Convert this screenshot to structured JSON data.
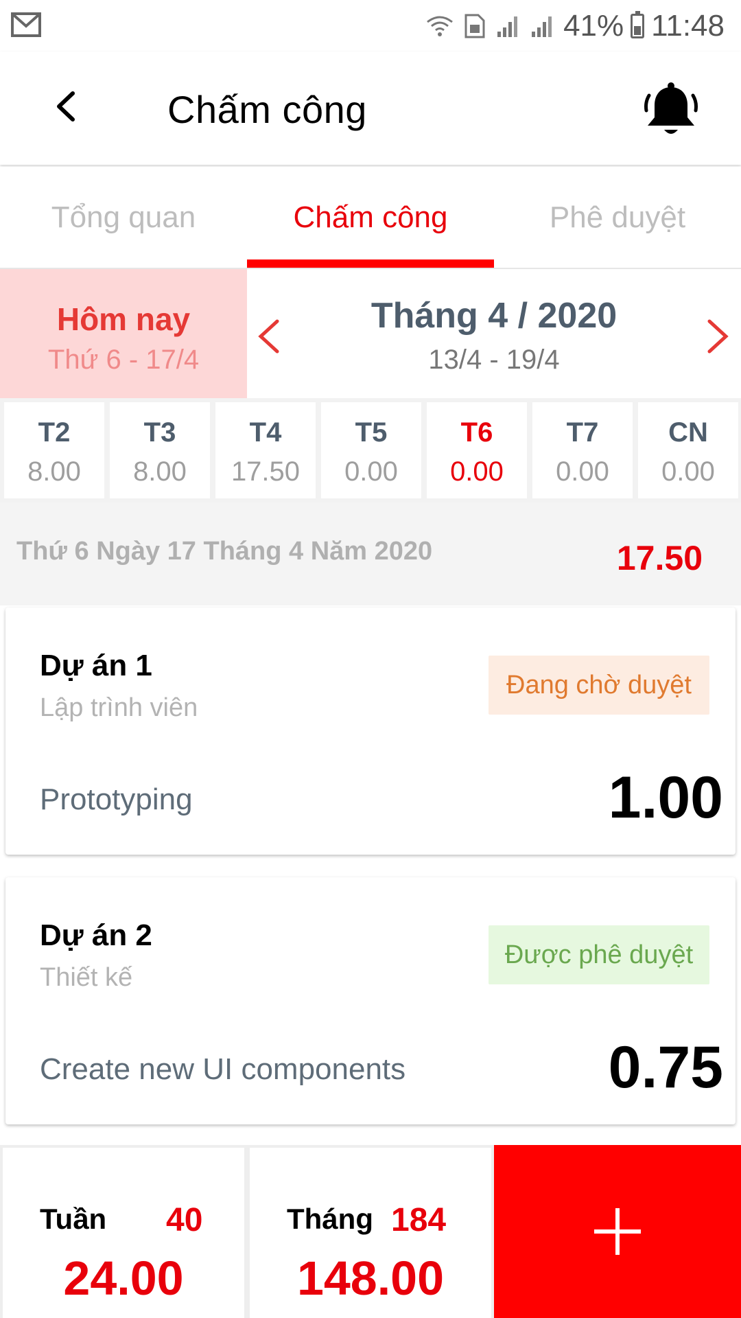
{
  "status_bar": {
    "battery": "41%",
    "time": "11:48",
    "icons": [
      "gmail-icon",
      "wifi-icon",
      "data-sim-icon",
      "signal-icon",
      "signal-icon",
      "battery-icon"
    ]
  },
  "app_bar": {
    "title": "Chấm công",
    "back_icon": "chevron-left-icon",
    "notification_icon": "bell-icon"
  },
  "tabs": [
    {
      "label": "Tổng quan",
      "active": false
    },
    {
      "label": "Chấm công",
      "active": true
    },
    {
      "label": "Phê duyệt",
      "active": false
    }
  ],
  "date_header": {
    "today_label": "Hôm nay",
    "today_date": "Thứ 6 - 17/4",
    "month": "Tháng 4 / 2020",
    "week_range": "13/4 - 19/4"
  },
  "days": [
    {
      "name": "T2",
      "value": "8.00",
      "active": false
    },
    {
      "name": "T3",
      "value": "8.00",
      "active": false
    },
    {
      "name": "T4",
      "value": "17.50",
      "active": false
    },
    {
      "name": "T5",
      "value": "0.00",
      "active": false
    },
    {
      "name": "T6",
      "value": "0.00",
      "active": true
    },
    {
      "name": "T7",
      "value": "0.00",
      "active": false
    },
    {
      "name": "CN",
      "value": "0.00",
      "active": false
    }
  ],
  "summary": {
    "date_text": "Thứ 6 Ngày 17 Tháng 4 Năm 2020",
    "total": "17.50"
  },
  "entries": [
    {
      "project": "Dự án 1",
      "role": "Lập trình viên",
      "status": "Đang chờ duyệt",
      "task": "Prototyping",
      "hours": "1.00"
    },
    {
      "project": "Dự án 2",
      "role": "Thiết kế",
      "status": "Được phê duyệt",
      "task": "Create new UI components",
      "hours": "0.75"
    }
  ],
  "totals": {
    "week_label": "Tuần",
    "week_target": "40",
    "week_value": "24.00",
    "month_label": "Tháng",
    "month_target": "184",
    "month_value": "148.00"
  },
  "colors": {
    "accent": "#ff0000",
    "today_bg": "#fdd7d7",
    "pending_bg": "#fdece1",
    "pending_text": "#e07a2f",
    "approved_bg": "#e6f8df",
    "approved_text": "#6aa84f",
    "month_text": "#4e5d6c"
  }
}
